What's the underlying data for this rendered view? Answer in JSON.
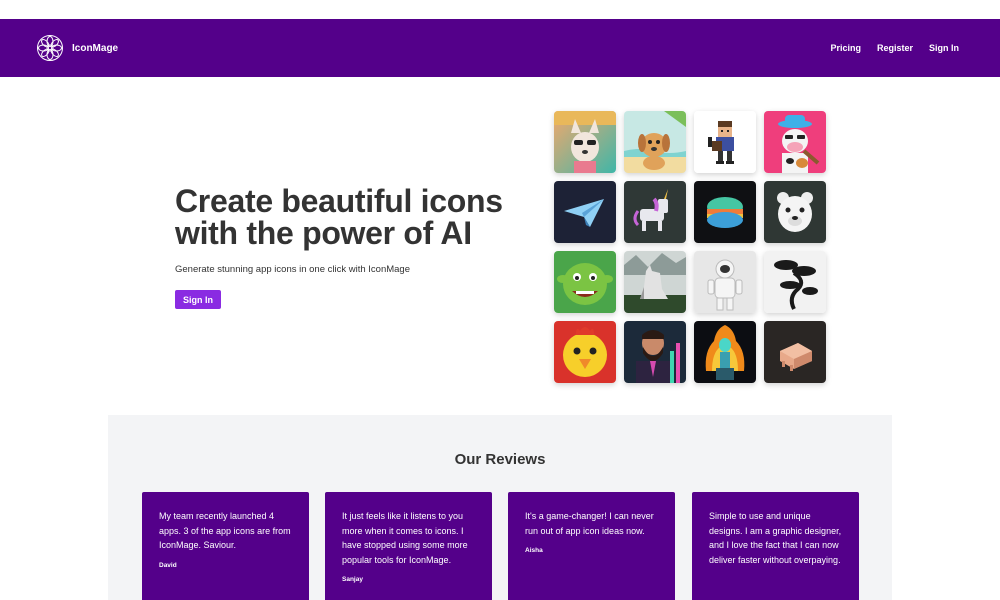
{
  "navbar": {
    "brand": "IconMage",
    "links": [
      "Pricing",
      "Register",
      "Sign In"
    ],
    "background": "#54008a"
  },
  "hero": {
    "title_line1": "Create beautiful icons",
    "title_line2": "with the power of AI",
    "subtitle": "Generate stunning app icons in one click with IconMage",
    "button": "Sign In",
    "button_color": "#8a2be2"
  },
  "gallery": {
    "icons": [
      "dog-sunglasses-icon",
      "puppy-beach-icon",
      "pixel-guitarist-icon",
      "cow-cowboy-icon",
      "paper-plane-icon",
      "unicorn-icon",
      "macaron-icon",
      "polar-bear-icon",
      "ogre-icon",
      "wolf-icon",
      "astronaut-icon",
      "bonsai-tree-icon",
      "chick-icon",
      "bearded-man-icon",
      "flaming-skeleton-icon",
      "pig-icon"
    ]
  },
  "reviews": {
    "title": "Our Reviews",
    "items": [
      {
        "text": "My team recently launched 4 apps. 3 of the app icons are from IconMage. Saviour.",
        "author": "David"
      },
      {
        "text": "It just feels like it listens to you more when it comes to icons. I have stopped using some more popular tools for IconMage.",
        "author": "Sanjay"
      },
      {
        "text": "It's a game-changer! I can never run out of app icon ideas now.",
        "author": "Aisha"
      },
      {
        "text": "Simple to use and unique designs. I am a graphic designer, and I love the fact that I can now deliver faster without overpaying.",
        "author": ""
      }
    ]
  }
}
